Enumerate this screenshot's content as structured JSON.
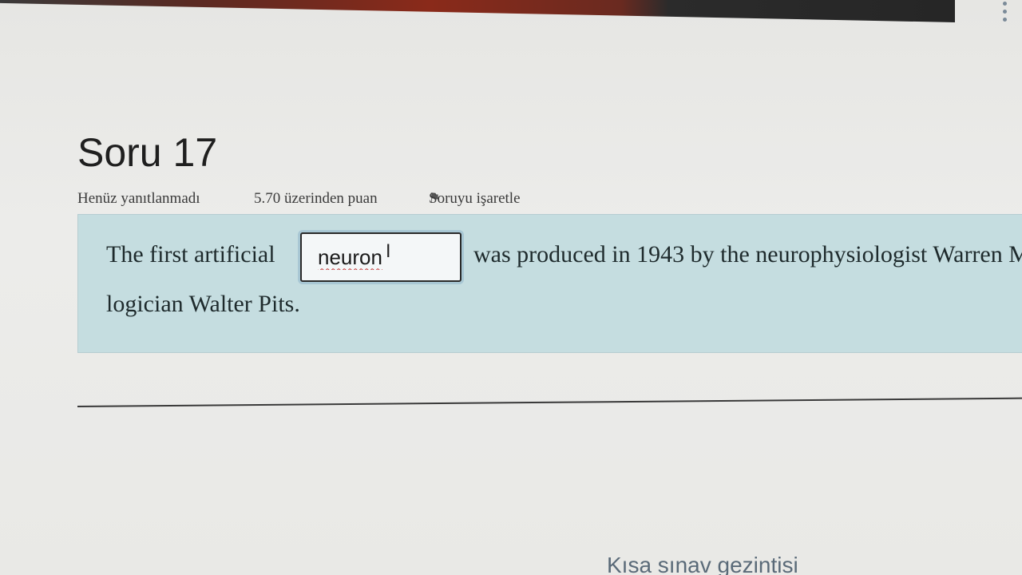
{
  "question": {
    "title": "Soru 17",
    "status": "Henüz yanıtlanmadı",
    "grade": "5.70 üzerinden puan",
    "flag_label": "Soruyu işaretle",
    "text_before": "The first artificial",
    "answer_value": "neuron",
    "text_after": "was produced in 1943 by the neurophysiologist Warren M",
    "text_line2": "logician Walter Pits."
  },
  "navigation": {
    "heading": "Kısa sınav gezintisi"
  },
  "icons": {
    "flag": "flag-icon",
    "text_cursor": "i-beam-cursor-icon"
  },
  "colors": {
    "content_background": "#c5dde0",
    "input_border": "#2a2a2a",
    "focus_ring": "#a8c7d4"
  }
}
